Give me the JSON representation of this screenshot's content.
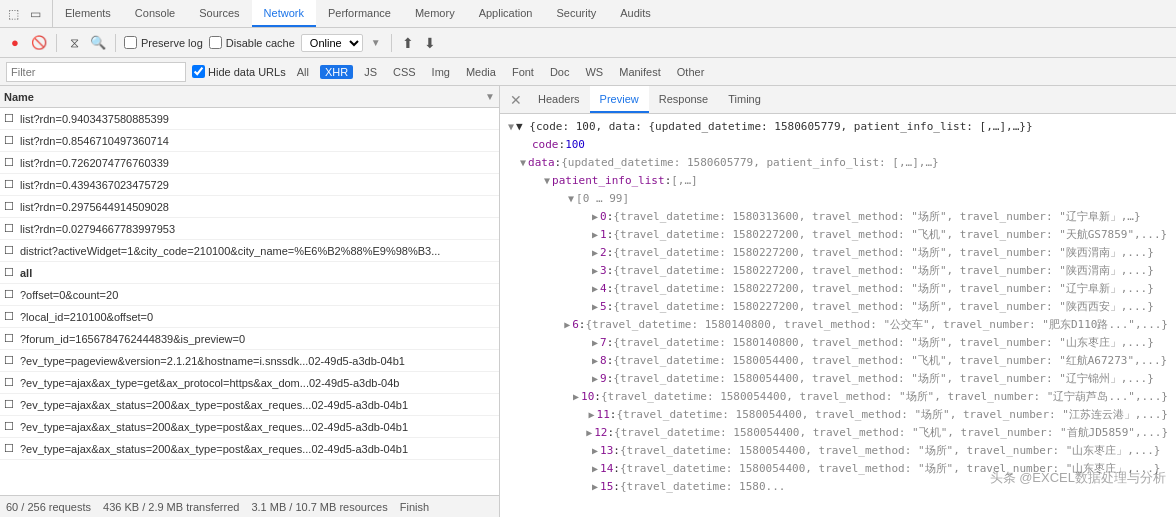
{
  "topTabs": {
    "icons": [
      "☰",
      "⬜"
    ],
    "tabs": [
      {
        "label": "Elements",
        "active": false
      },
      {
        "label": "Console",
        "active": false
      },
      {
        "label": "Sources",
        "active": false
      },
      {
        "label": "Network",
        "active": true
      },
      {
        "label": "Performance",
        "active": false
      },
      {
        "label": "Memory",
        "active": false
      },
      {
        "label": "Application",
        "active": false
      },
      {
        "label": "Security",
        "active": false
      },
      {
        "label": "Audits",
        "active": false
      }
    ]
  },
  "toolbar": {
    "preserveLog": "Preserve log",
    "disableCache": "Disable cache",
    "online": "Online"
  },
  "filterRow": {
    "placeholder": "Filter",
    "hideDataUrls": "Hide data URLs",
    "types": [
      "All",
      "XHR",
      "JS",
      "CSS",
      "Img",
      "Media",
      "Font",
      "Doc",
      "WS",
      "Manifest",
      "Other"
    ],
    "activeType": "XHR"
  },
  "listHeader": {
    "name": "Name"
  },
  "requests": [
    {
      "name": "list?rdn=0.9403437580885399"
    },
    {
      "name": "list?rdn=0.8546710497360714"
    },
    {
      "name": "list?rdn=0.7262074776760339"
    },
    {
      "name": "list?rdn=0.4394367023475729"
    },
    {
      "name": "list?rdn=0.2975644914509028"
    },
    {
      "name": "list?rdn=0.02794667783997953"
    },
    {
      "name": "district?activeWidget=1&city_code=210100&city_name=%E6%B2%88%E9%98%B3..."
    },
    {
      "name": "all",
      "bold": true
    },
    {
      "name": "?offset=0&count=20"
    },
    {
      "name": "?local_id=210100&offset=0"
    },
    {
      "name": "?forum_id=1656784762444839&is_preview=0"
    },
    {
      "name": "?ev_type=pageview&version=2.1.21&hostname=i.snssdk...02-49d5-a3db-04b1"
    },
    {
      "name": "?ev_type=ajax&ax_type=get&ax_protocol=https&ax_dom...02-49d5-a3db-04b"
    },
    {
      "name": "?ev_type=ajax&ax_status=200&ax_type=post&ax_reques...02-49d5-a3db-04b1"
    },
    {
      "name": "?ev_type=ajax&ax_status=200&ax_type=post&ax_reques...02-49d5-a3db-04b1"
    },
    {
      "name": "?ev_type=ajax&ax_status=200&ax_type=post&ax_reques...02-49d5-a3db-04b1"
    }
  ],
  "statusBar": {
    "requests": "60 / 256 requests",
    "size": "436 KB / 2.9 MB transferred",
    "resources": "3.1 MB / 10.7 MB resources",
    "finish": "Finish"
  },
  "rightTabs": [
    "Headers",
    "Preview",
    "Response",
    "Timing"
  ],
  "activeRightTab": "Preview",
  "preview": {
    "topSummary": "▼ {code: 100, data: {updated_datetime: 1580605779, patient_info_list: [,…],…}}",
    "lines": [
      {
        "indent": 2,
        "content": "code: 100",
        "type": "keyval",
        "key": "code",
        "val": "100",
        "valType": "number"
      },
      {
        "indent": 2,
        "content": "▼ data: {updated_datetime: 1580605779, patient_info_list: [,…],…}",
        "type": "summary"
      },
      {
        "indent": 4,
        "content": "▼ patient_info_list: [,…]",
        "type": "summary"
      },
      {
        "indent": 6,
        "content": "▼ [0 … 99]",
        "type": "summary"
      },
      {
        "indent": 8,
        "content": "▶ 0: {travel_datetime: 1580313600, travel_method: \"场所\", travel_number: \"辽宁阜新」,…}",
        "type": "entry",
        "idx": "0"
      },
      {
        "indent": 8,
        "content": "▶ 1: {travel_datetime: 1580227200, travel_method: \"飞机\", travel_number: \"天航GS7859\",...}",
        "type": "entry",
        "idx": "1"
      },
      {
        "indent": 8,
        "content": "▶ 2: {travel_datetime: 1580227200, travel_method: \"场所\", travel_number: \"陕西渭南」,...}",
        "type": "entry",
        "idx": "2"
      },
      {
        "indent": 8,
        "content": "▶ 3: {travel_datetime: 1580227200, travel_method: \"场所\", travel_number: \"陕西渭南」,...}",
        "type": "entry",
        "idx": "3"
      },
      {
        "indent": 8,
        "content": "▶ 4: {travel_datetime: 1580227200, travel_method: \"场所\", travel_number: \"辽宁阜新」,...}",
        "type": "entry",
        "idx": "4"
      },
      {
        "indent": 8,
        "content": "▶ 5: {travel_datetime: 1580227200, travel_method: \"场所\", travel_number: \"陕西西安」,...}",
        "type": "entry",
        "idx": "5"
      },
      {
        "indent": 8,
        "content": "▶ 6: {travel_datetime: 1580140800, travel_method: \"公交车\", travel_number: \"肥东D110路...\",...}",
        "type": "entry",
        "idx": "6"
      },
      {
        "indent": 8,
        "content": "▶ 7: {travel_datetime: 1580140800, travel_method: \"场所\", travel_number: \"山东枣庄」,...}",
        "type": "entry",
        "idx": "7"
      },
      {
        "indent": 8,
        "content": "▶ 8: {travel_datetime: 1580054400, travel_method: \"飞机\", travel_number: \"红航A67273\",...}",
        "type": "entry",
        "idx": "8"
      },
      {
        "indent": 8,
        "content": "▶ 9: {travel_datetime: 1580054400, travel_method: \"场所\", travel_number: \"辽宁锦州」,...}",
        "type": "entry",
        "idx": "9"
      },
      {
        "indent": 8,
        "content": "▶ 10: {travel_datetime: 1580054400, travel_method: \"场所\", travel_number: \"辽宁葫芦岛...\",...}",
        "type": "entry",
        "idx": "10"
      },
      {
        "indent": 8,
        "content": "▶ 11: {travel_datetime: 1580054400, travel_method: \"场所\", travel_number: \"江苏连云港」,...}",
        "type": "entry",
        "idx": "11"
      },
      {
        "indent": 8,
        "content": "▶ 12: {travel_datetime: 1580054400, travel_method: \"飞机\", travel_number: \"首航JD5859\",...}",
        "type": "entry",
        "idx": "12"
      },
      {
        "indent": 8,
        "content": "▶ 13: {travel_datetime: 1580054400, travel_method: \"场所\", travel_number: \"山东枣庄」,...}",
        "type": "entry",
        "idx": "13"
      },
      {
        "indent": 8,
        "content": "▶ 14: {travel_datetime: 1580054400, travel_method: \"场所\", travel_number: \"山东枣庄」,...}",
        "type": "entry",
        "idx": "14"
      },
      {
        "indent": 8,
        "content": "▶ 15: {travel_datetime: 1580...",
        "type": "entry",
        "idx": "15"
      }
    ]
  },
  "watermark": "头条 @EXCEL数据处理与分析"
}
